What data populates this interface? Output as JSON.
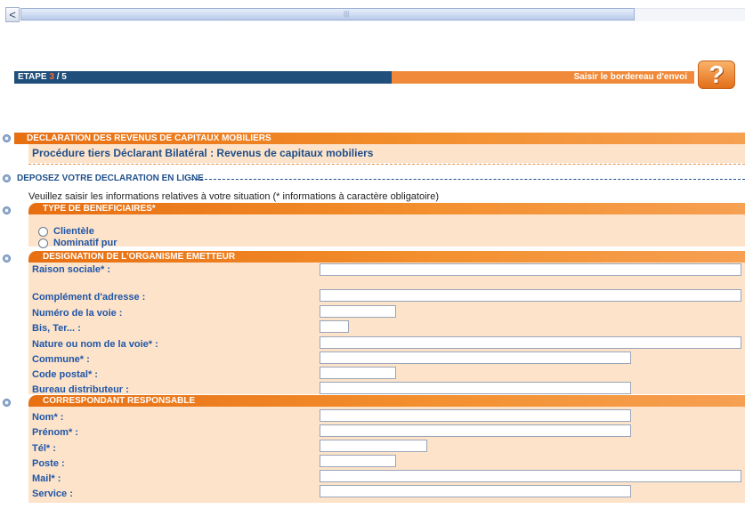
{
  "step": {
    "label": "ETAPE ",
    "number": "3",
    "total": " / 5",
    "title": "Saisir le bordereau d'envoi"
  },
  "help_label": "?",
  "scrollbar": {
    "left_arrow": "<",
    "grip": "|||"
  },
  "section1": {
    "header": "DECLARATION DES REVENUS DE CAPITAUX MOBILIERS",
    "subtitle": "Procédure tiers Déclarant Bilatéral : Revenus de capitaux mobiliers"
  },
  "depose": "DEPOSEZ VOTRE DECLARATION EN LIGNE",
  "instruction": "Veuillez saisir les informations relatives à votre situation (* informations à caractère obligatoire)",
  "beneficiaires": {
    "header": "TYPE DE BENEFICIAIRES*",
    "options": [
      "Clientèle",
      "Nominatif pur"
    ]
  },
  "organisme": {
    "header": "DESIGNATION DE L'ORGANISME EMETTEUR",
    "fields": [
      {
        "label": "Raison sociale* :",
        "value": ""
      },
      {
        "label": "Complément d'adresse :",
        "value": ""
      },
      {
        "label": "Numéro de la voie :",
        "value": ""
      },
      {
        "label": "Bis, Ter... :",
        "value": ""
      },
      {
        "label": "Nature ou nom de la voie* :",
        "value": ""
      },
      {
        "label": "Commune* :",
        "value": ""
      },
      {
        "label": "Code postal* :",
        "value": ""
      },
      {
        "label": "Bureau distributeur :",
        "value": ""
      }
    ]
  },
  "correspondant": {
    "header": "CORRESPONDANT RESPONSABLE",
    "fields": [
      {
        "label": "Nom* :",
        "value": ""
      },
      {
        "label": "Prénom* :",
        "value": ""
      },
      {
        "label": "Tél* :",
        "value": ""
      },
      {
        "label": "Poste :",
        "value": ""
      },
      {
        "label": "Mail* :",
        "value": ""
      },
      {
        "label": "Service :",
        "value": ""
      }
    ]
  }
}
